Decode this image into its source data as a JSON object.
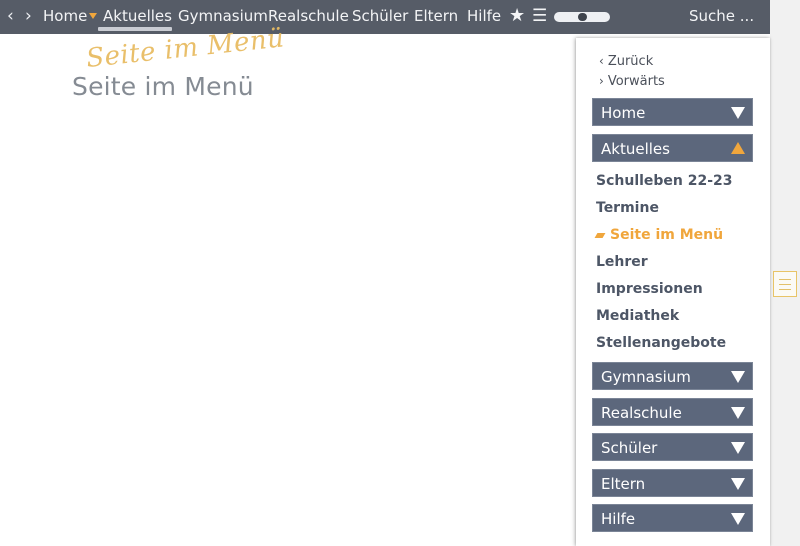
{
  "topbar": {
    "back_icon": "chevron-left-icon",
    "forward_icon": "chevron-right-icon",
    "items": [
      {
        "label": "Home"
      },
      {
        "label": "Aktuelles"
      },
      {
        "label": "Gymnasium"
      },
      {
        "label": "Realschule"
      },
      {
        "label": "Schüler"
      },
      {
        "label": "Eltern"
      },
      {
        "label": "Hilfe"
      }
    ],
    "active_item": "Aktuelles",
    "star_icon": "star-icon",
    "menu_icon": "hamburger-menu-icon",
    "toggle_icon": "toggle-switch",
    "search_label": "Suche ..."
  },
  "logo": {
    "script_text": "Seite im Menü",
    "main_text": "Seite im Menü"
  },
  "panel": {
    "back_label": "Zurück",
    "forward_label": "Vorwärts",
    "categories": [
      {
        "label": "Home",
        "expanded": false
      },
      {
        "label": "Aktuelles",
        "expanded": true
      },
      {
        "label": "Gymnasium",
        "expanded": false
      },
      {
        "label": "Realschule",
        "expanded": false
      },
      {
        "label": "Schüler",
        "expanded": false
      },
      {
        "label": "Eltern",
        "expanded": false
      },
      {
        "label": "Hilfe",
        "expanded": false
      }
    ],
    "sub_items": [
      {
        "label": "Schulleben 22-23"
      },
      {
        "label": "Termine"
      },
      {
        "label": "Seite im Menü",
        "current": true
      },
      {
        "label": "Lehrer"
      },
      {
        "label": "Impressionen"
      },
      {
        "label": "Mediathek"
      },
      {
        "label": "Stellenangebote"
      }
    ]
  },
  "colors": {
    "topbar_bg": "#565c67",
    "accent": "#f0a63c",
    "category_bg": "#5c677c",
    "logo_script": "#e8bc63",
    "logo_main": "#858b93"
  },
  "handle_icon": "menu-handle-icon"
}
